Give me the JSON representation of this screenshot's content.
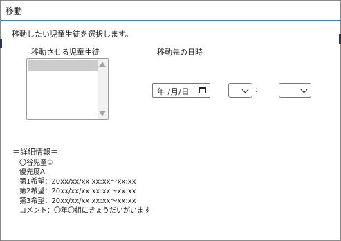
{
  "window": {
    "title": "移動"
  },
  "instruction": "移動したい児童生徒を選択します。",
  "students": {
    "label": "移動させる児童生徒"
  },
  "datetime": {
    "label": "移動先の日時",
    "date_display": "年 /月/日",
    "colon": ":"
  },
  "details": {
    "heading": "＝詳細情報＝",
    "lines": [
      "〇谷児童①",
      "優先度A",
      "第1希望：20xx/xx/xx xx:xx～xx:xx",
      "第2希望：20xx/xx/xx xx:xx～xx:xx",
      "第3希望：20xx/xx/xx xx:xx～xx:xx",
      "コメント：〇年〇組にきょうだいがいます"
    ]
  }
}
